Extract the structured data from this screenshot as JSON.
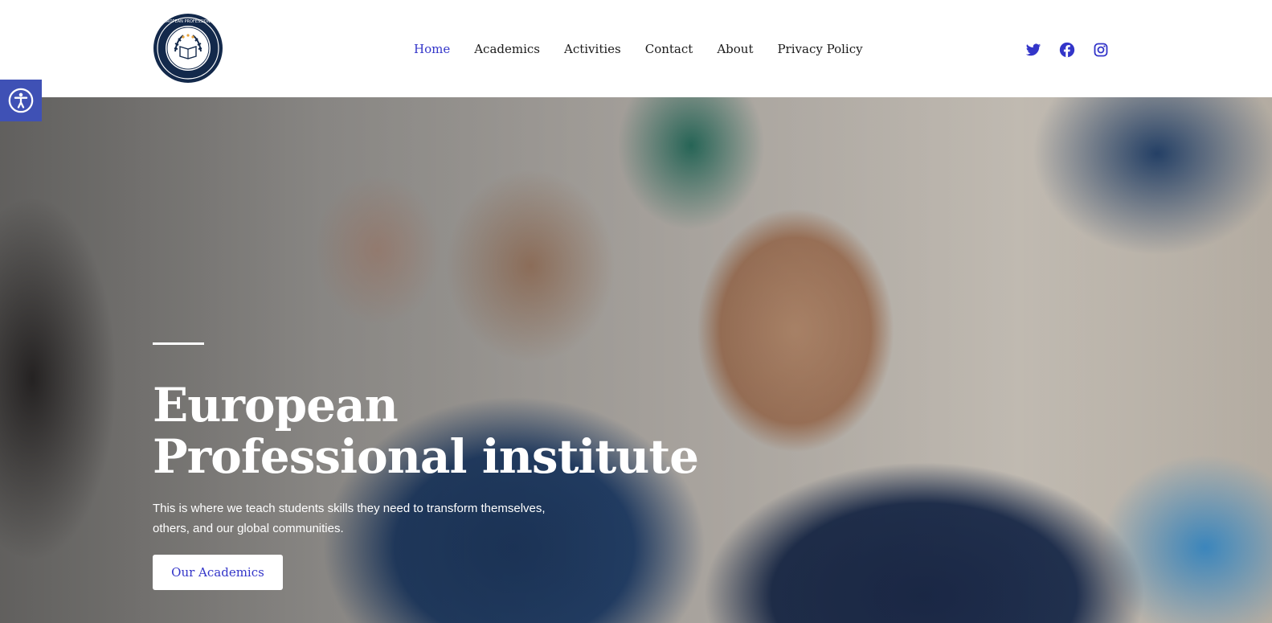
{
  "brand": {
    "logo_icon": "book-laurel-crest-icon",
    "logo_arc_text": "EUROPEAN PROFESSIONAL"
  },
  "nav": {
    "items": [
      {
        "label": "Home",
        "active": true
      },
      {
        "label": "Academics"
      },
      {
        "label": "Activities"
      },
      {
        "label": "Contact"
      },
      {
        "label": "About"
      },
      {
        "label": "Privacy Policy"
      }
    ]
  },
  "social": [
    {
      "icon": "twitter-icon"
    },
    {
      "icon": "facebook-icon"
    },
    {
      "icon": "instagram-icon"
    }
  ],
  "accessibility": {
    "icon": "accessibility-icon"
  },
  "hero": {
    "title_line1": "European",
    "title_line2": "Professional institute",
    "text": "This is where we teach students skills they need to transform themselves, others, and our global communities.",
    "button_label": "Our Academics"
  },
  "colors": {
    "accent": "#3335c9",
    "accessibility_bg": "#3f51b5",
    "logo_navy": "#13294b"
  }
}
